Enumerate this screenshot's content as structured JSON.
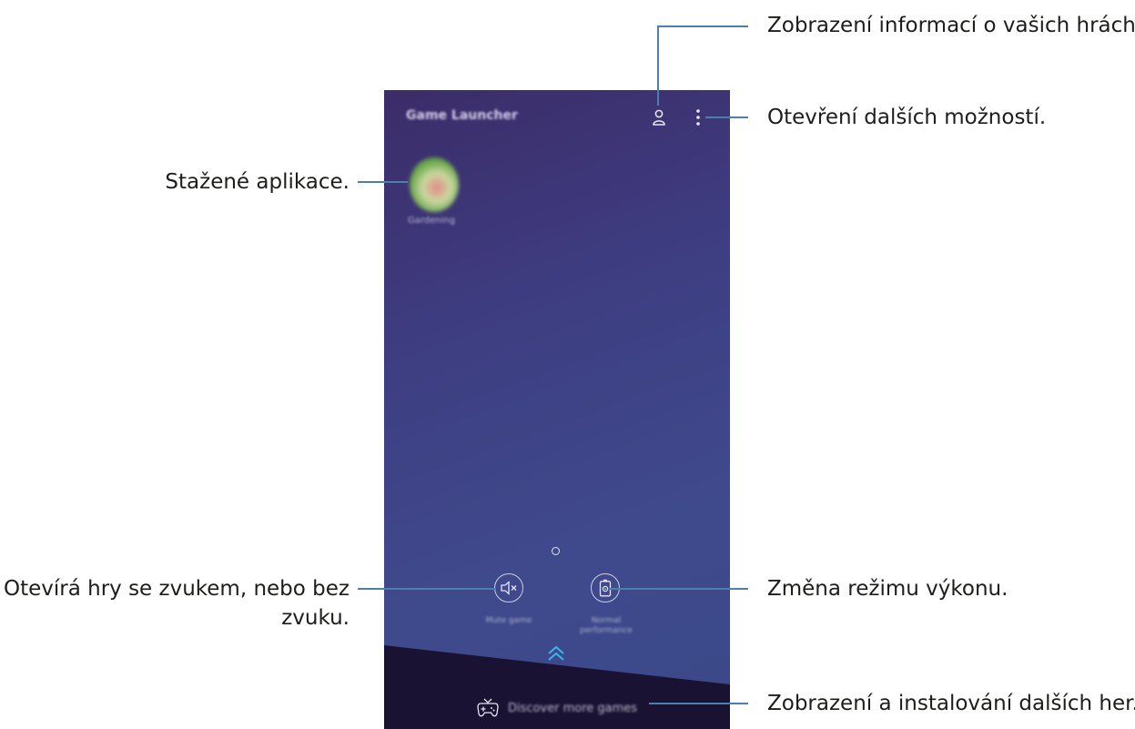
{
  "screen": {
    "app_title": "Game Launcher",
    "app_tile_label": "Gardening",
    "mute_label": "Mute game",
    "performance_label": "Normal performance",
    "discover_label": "Discover more games"
  },
  "callouts": {
    "game_info": "Zobrazení informací o vašich hrách.",
    "more_options": "Otevření dalších možností.",
    "downloaded_apps": "Stažené aplikace.",
    "sound_line1": "Otevírá hry se zvukem, nebo bez",
    "sound_line2": "zvuku.",
    "performance_mode": "Změna režimu výkonu.",
    "discover_games": "Zobrazení a instalování dalších her."
  },
  "icons": {
    "profile": "profile-icon",
    "more": "more-options-icon",
    "mute": "mute-icon",
    "performance": "performance-battery-icon",
    "expand": "chevron-up-icon",
    "gamepad": "gamepad-icon"
  },
  "colors": {
    "callout_line": "#4a7fae",
    "expand_accent": "#38b7e6",
    "screen_bg": "#3e3d82",
    "bottom_band": "#1a1232"
  }
}
